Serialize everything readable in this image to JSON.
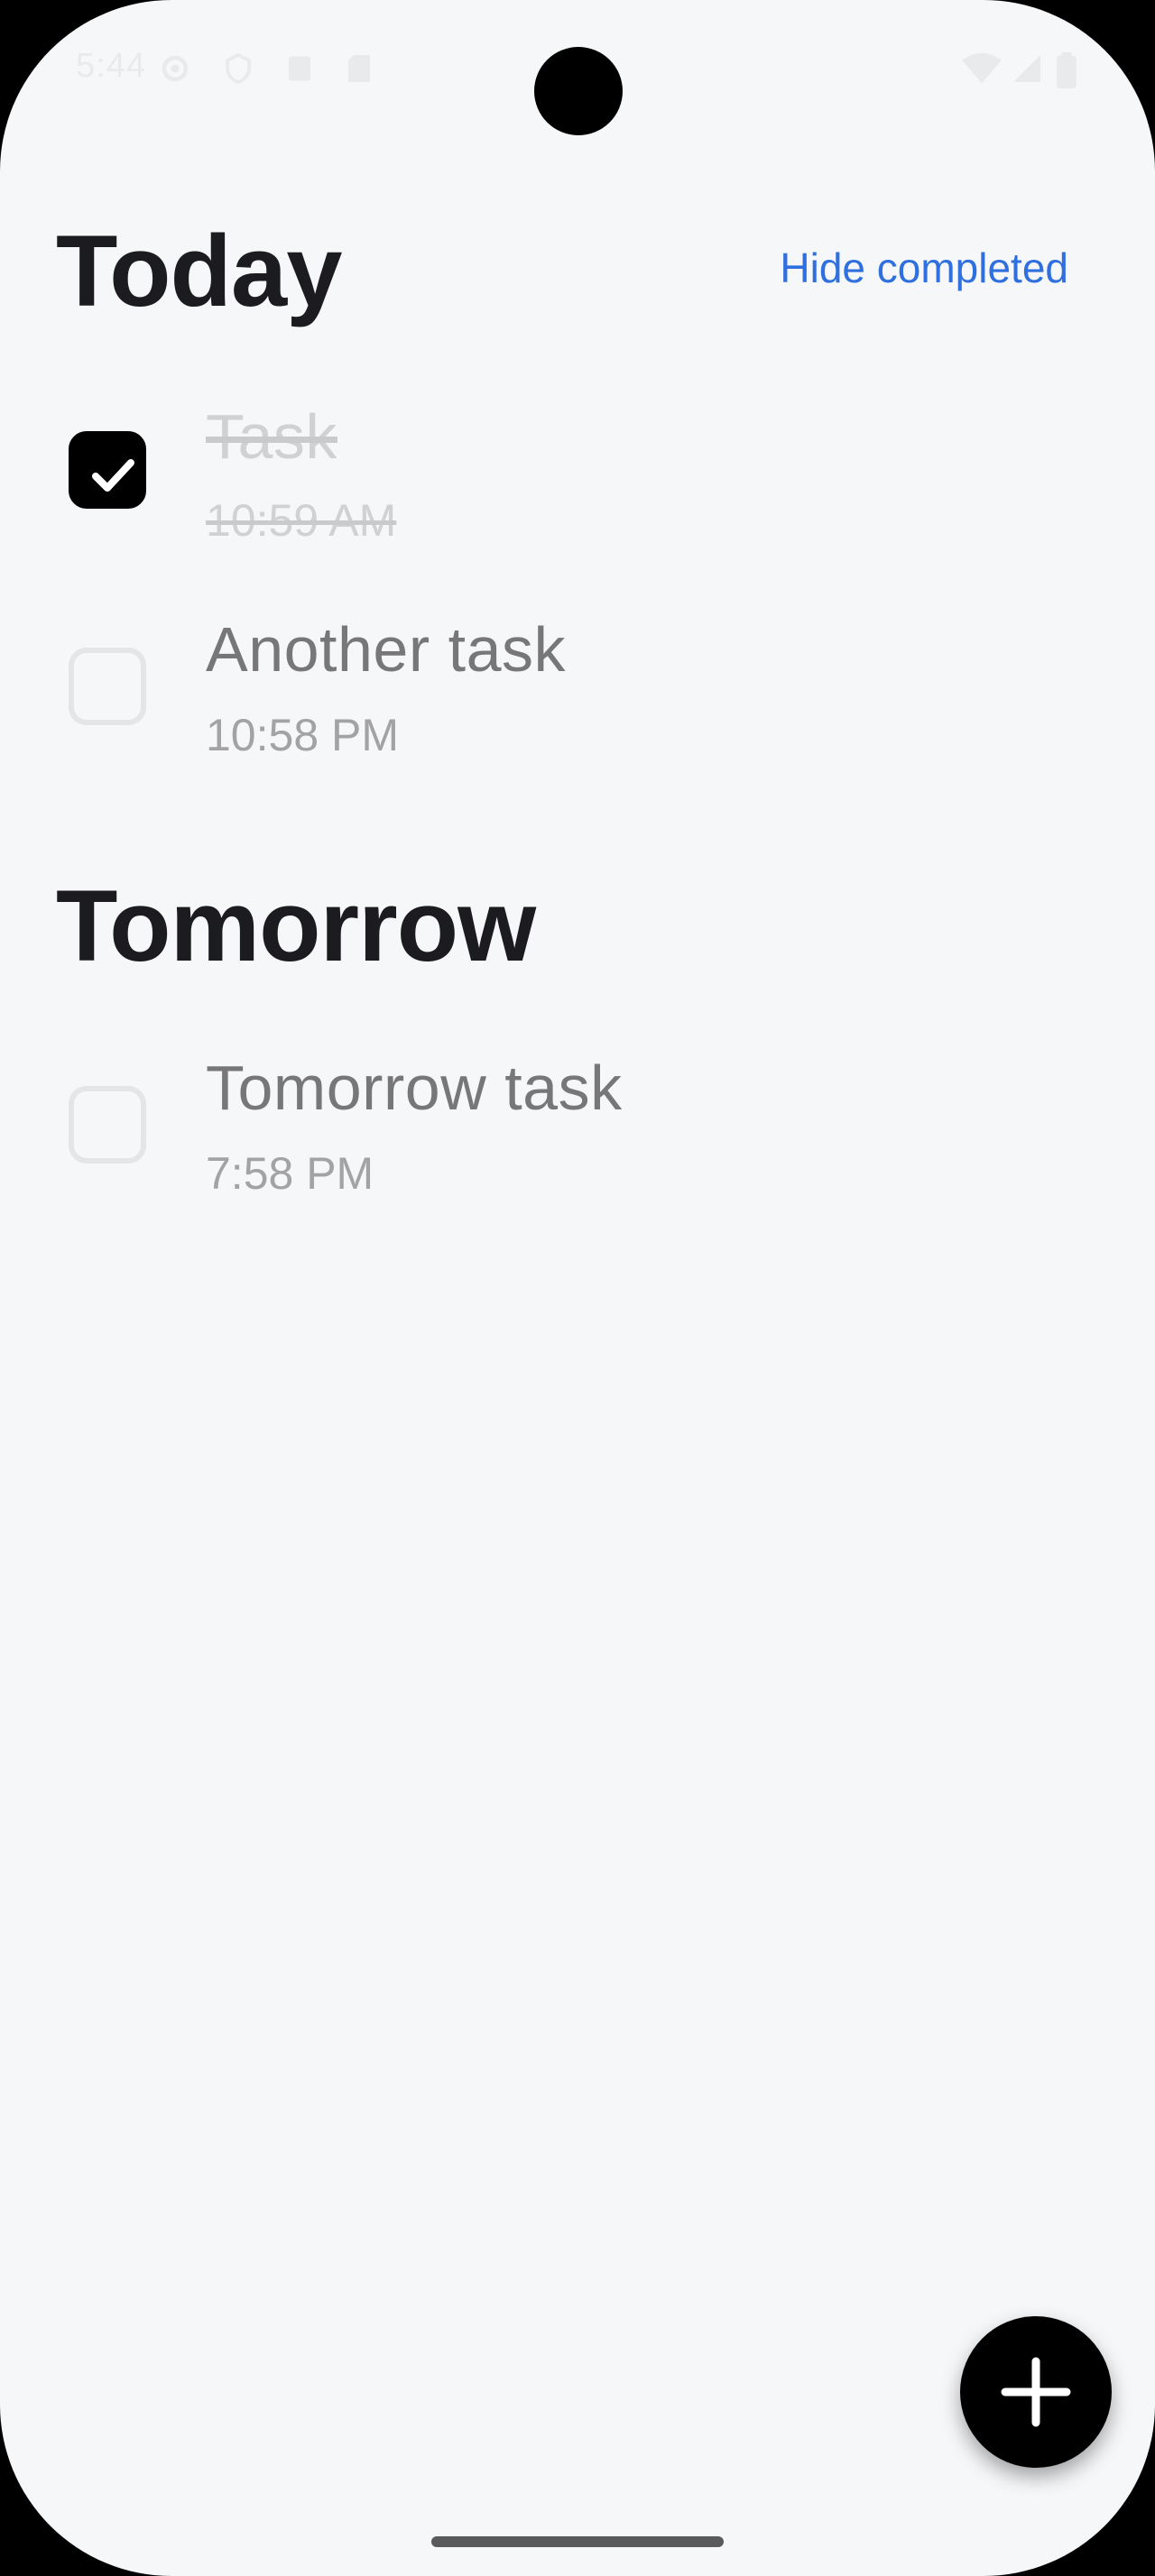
{
  "status_bar": {
    "time": "5:44",
    "icons": [
      "gear-icon",
      "shield-icon",
      "battery-saver-icon",
      "sd-card-icon",
      "wifi-icon",
      "signal-icon",
      "battery-icon"
    ]
  },
  "sections": {
    "today": {
      "title": "Today",
      "action_label": "Hide completed",
      "tasks": [
        {
          "title": "Task",
          "time": "10:59 AM",
          "completed": true
        },
        {
          "title": "Another task",
          "time": "10:58 PM",
          "completed": false
        }
      ]
    },
    "tomorrow": {
      "title": "Tomorrow",
      "tasks": [
        {
          "title": "Tomorrow task",
          "time": "7:58 PM",
          "completed": false
        }
      ]
    }
  },
  "fab": {
    "icon": "plus-icon"
  },
  "colors": {
    "background": "#f6f7f9",
    "accent": "#2f6fde",
    "title": "#1c1b1f",
    "task_text": "#77777a",
    "completed_text": "#d0d1d3"
  }
}
